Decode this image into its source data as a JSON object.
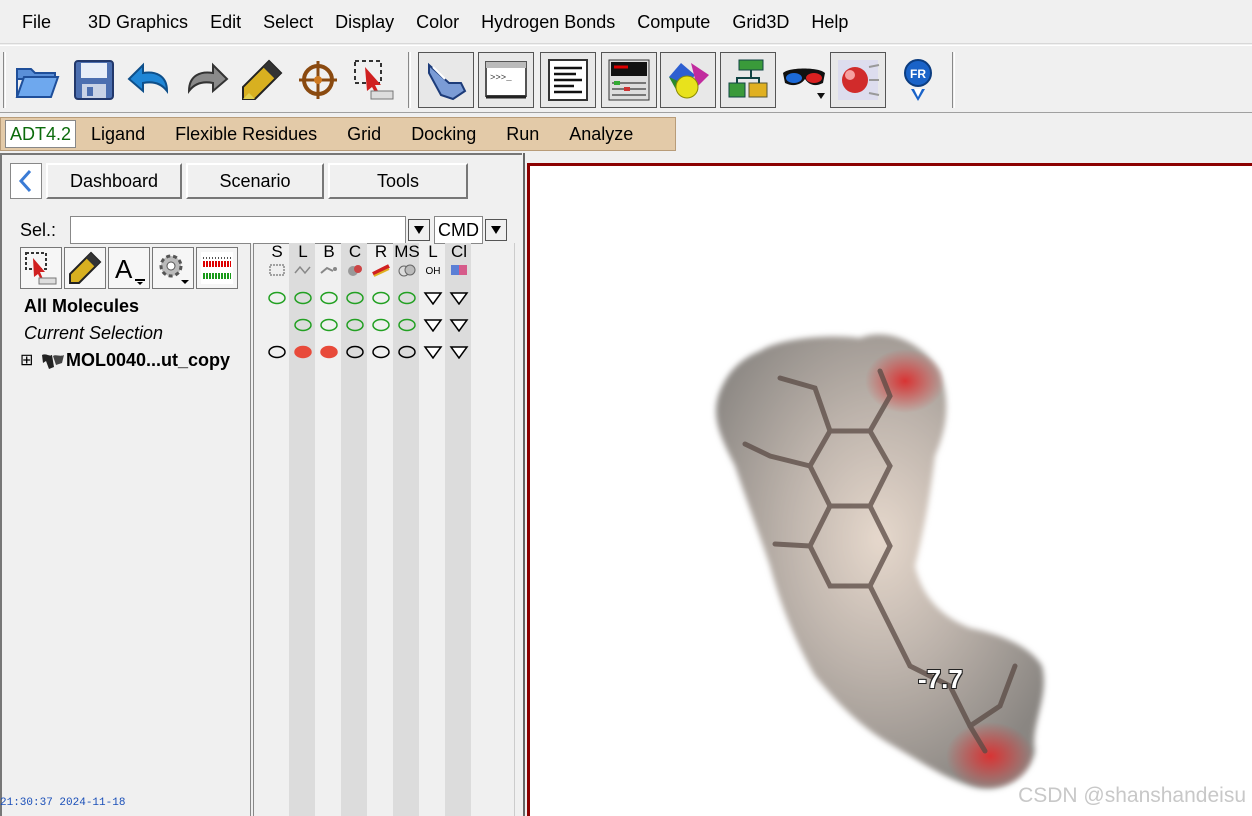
{
  "menu": [
    "File",
    "3D Graphics",
    "Edit",
    "Select",
    "Display",
    "Color",
    "Hydrogen Bonds",
    "Compute",
    "Grid3D",
    "Help"
  ],
  "toolbar": {
    "icons": [
      "open-folder-icon",
      "save-icon",
      "undo-icon",
      "redo-icon",
      "pencil-icon",
      "crosshair-icon",
      "select-icon",
      "hand-icon",
      "python-shell-icon",
      "message-log-icon",
      "dashboard-icon",
      "primitives-icon",
      "modeling-icon",
      "stereo-glasses-icon",
      "lights-icon",
      "fr-icon"
    ]
  },
  "adt": {
    "active": "ADT4.2",
    "tabs": [
      "Ligand",
      "Flexible Residues",
      "Grid",
      "Docking",
      "Run",
      "Analyze"
    ],
    "accent": "#e3caa8"
  },
  "dashboard": {
    "tabs": [
      "Dashboard",
      "Scenario",
      "Tools"
    ],
    "sel_label": "Sel.:",
    "sel_value": "",
    "cmd_label": "CMD",
    "columns": [
      "S",
      "L",
      "B",
      "C",
      "R",
      "MS",
      "L",
      "Cl"
    ],
    "col_sublabels": {
      "l2": "OH"
    },
    "rows": {
      "all": "All Molecules",
      "current": "Current Selection",
      "molecule": "MOL0040...ut_copy",
      "expand": "⊞"
    },
    "marks": {
      "all": [
        "green",
        "green",
        "green",
        "green",
        "green",
        "green",
        "tri",
        "tri"
      ],
      "current": [
        "none",
        "green",
        "green",
        "green",
        "green",
        "green",
        "tri",
        "tri"
      ],
      "molecule": [
        "black",
        "red",
        "red",
        "black",
        "black",
        "black",
        "tri",
        "tri"
      ]
    }
  },
  "viewer": {
    "score_label": "-7.7",
    "watermark": "CSDN @shanshandeisu",
    "border_color": "#8b0000"
  },
  "timestamp": "21:30:37 2024-11-18"
}
